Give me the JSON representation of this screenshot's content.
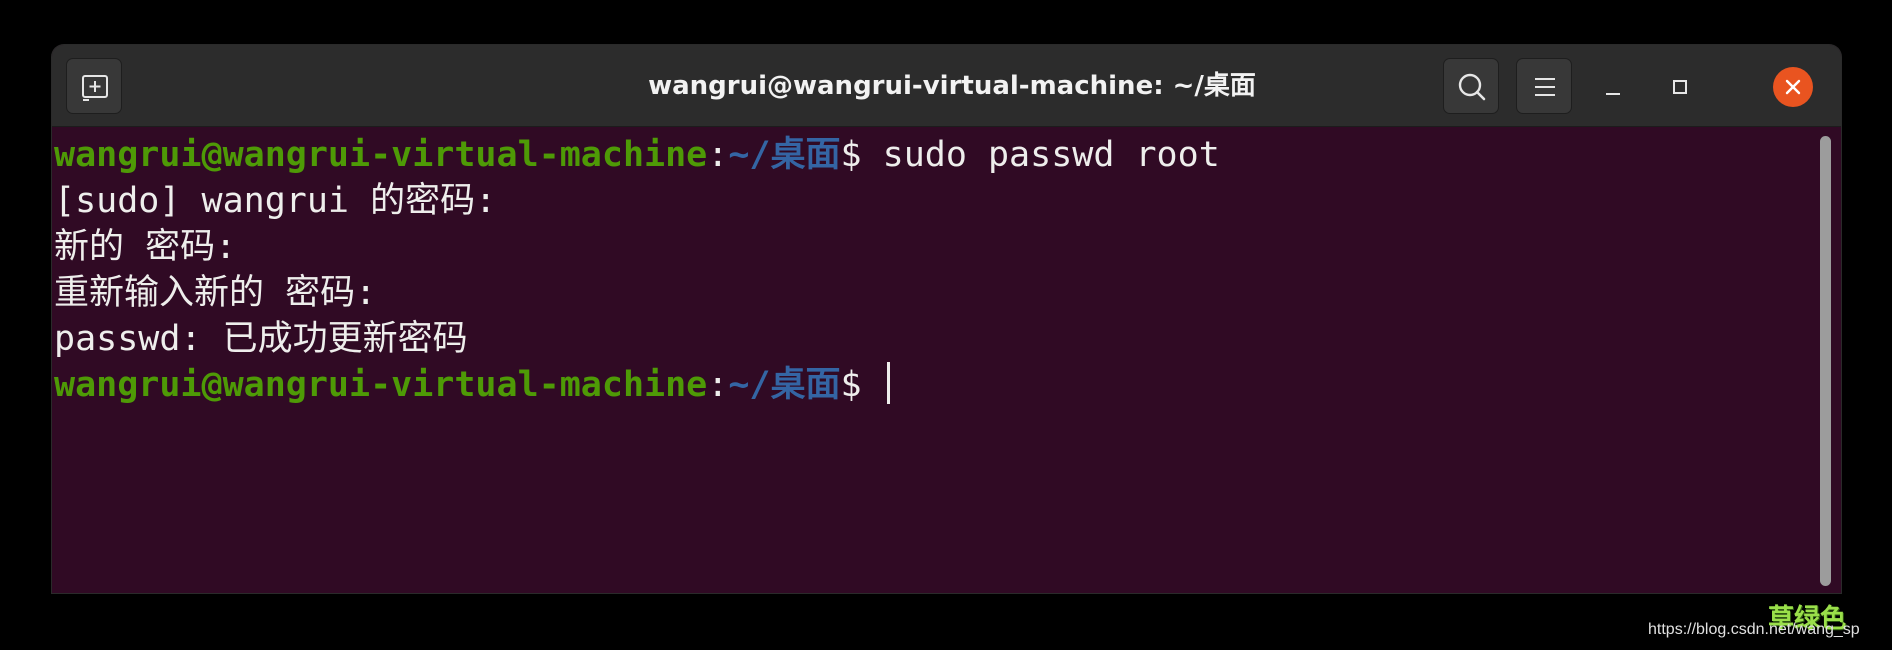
{
  "window": {
    "title": "wangrui@wangrui-virtual-machine: ~/桌面"
  },
  "icons": {
    "new_tab": "new-tab-icon",
    "search": "search-icon",
    "menu": "hamburger-menu-icon",
    "minimize": "minimize-icon",
    "maximize": "maximize-icon",
    "close": "close-icon"
  },
  "colors": {
    "terminal_bg": "#300a24",
    "prompt_user": "#4e9a06",
    "prompt_path": "#3465a4",
    "close_button": "#e95420"
  },
  "terminal": {
    "lines": [
      {
        "user": "wangrui@wangrui-virtual-machine",
        "colon": ":",
        "path": "~/桌面",
        "symbol": "$ ",
        "command": "sudo passwd root"
      },
      {
        "text": "[sudo] wangrui 的密码:"
      },
      {
        "text": "新的 密码:"
      },
      {
        "text": "重新输入新的 密码:"
      },
      {
        "text": "passwd: 已成功更新密码"
      },
      {
        "user": "wangrui@wangrui-virtual-machine",
        "colon": ":",
        "path": "~/桌面",
        "symbol": "$ ",
        "command": ""
      }
    ]
  },
  "watermark": {
    "url": "https://blog.csdn.net/wang_sp",
    "logo": "草绿色"
  }
}
